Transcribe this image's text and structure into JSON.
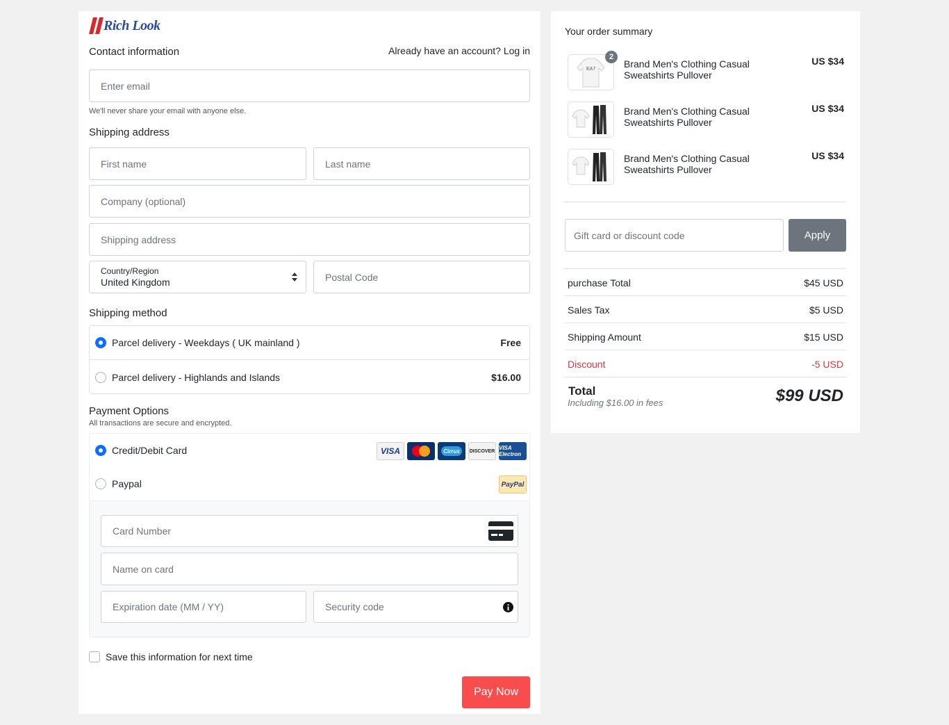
{
  "brand": {
    "name": "Rich Look"
  },
  "contact": {
    "heading": "Contact information",
    "login_prompt": "Already have an account? Log in",
    "email_placeholder": "Enter email",
    "email_help": "We'll never share your email with anyone else."
  },
  "shipping": {
    "heading": "Shipping address",
    "first_name_placeholder": "First name",
    "last_name_placeholder": "Last name",
    "company_placeholder": "Company (optional)",
    "address_placeholder": "Shipping address",
    "country_label": "Country/Region",
    "country_value": "United Kingdom",
    "postal_placeholder": "Postal Code"
  },
  "shipping_method": {
    "heading": "Shipping method",
    "options": [
      {
        "label": "Parcel delivery - Weekdays ( UK mainland )",
        "price": "Free",
        "selected": true
      },
      {
        "label": "Parcel delivery - Highlands and Islands",
        "price": "$16.00",
        "selected": false
      }
    ]
  },
  "payment": {
    "heading": "Payment Options",
    "subtext": "All transactions are secure and encrypted.",
    "options": [
      {
        "label": "Credit/Debit Card",
        "selected": true
      },
      {
        "label": "Paypal",
        "selected": false
      }
    ],
    "card_logos": [
      "VISA",
      "MasterCard",
      "Cirrus",
      "DISCOVER",
      "VISA Electron"
    ],
    "paypal_logo": "PayPal",
    "card_number_placeholder": "Card Number",
    "name_on_card_placeholder": "Name on card",
    "expiration_placeholder": "Expiration date (MM / YY)",
    "security_placeholder": "Security code"
  },
  "save_info_label": "Save this information for next time",
  "pay_button": "Pay Now",
  "summary": {
    "heading": "Your order summary",
    "items": [
      {
        "name": "Brand Men's Clothing Casual Sweatshirts Pullover",
        "price": "US $34",
        "quantity": "2",
        "thumb_text": "EA7"
      },
      {
        "name": "Brand Men's Clothing Casual Sweatshirts Pullover",
        "price": "US $34"
      },
      {
        "name": "Brand Men's Clothing Casual Sweatshirts Pullover",
        "price": "US $34"
      }
    ],
    "discount_placeholder": "Gift card or discount code",
    "apply_button": "Apply",
    "rows": [
      {
        "label": "purchase Total",
        "value": "$45 USD"
      },
      {
        "label": "Sales Tax",
        "value": "$5 USD"
      },
      {
        "label": "Shipping Amount",
        "value": "$15 USD"
      },
      {
        "label": "Discount",
        "value": "-5 USD"
      }
    ],
    "total_label": "Total",
    "total_note": "Including $16.00 in fees",
    "total_value": "$99 USD"
  },
  "colors": {
    "accent_red": "#f94c4c",
    "radio_blue": "#0d6efd",
    "discount_red": "#dc3545",
    "apply_gray": "#6c757d",
    "logo_blue": "#2a4d9b",
    "logo_red": "#d9272e"
  }
}
